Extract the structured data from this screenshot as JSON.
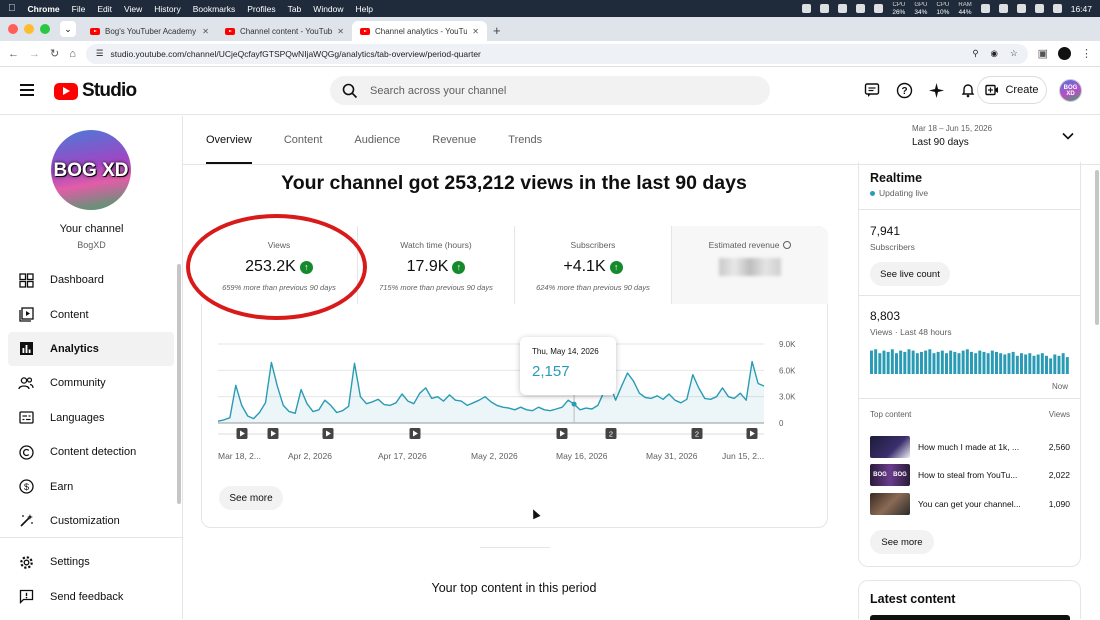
{
  "menubar": {
    "app": "Chrome",
    "items": [
      "File",
      "Edit",
      "View",
      "History",
      "Bookmarks",
      "Profiles",
      "Tab",
      "Window",
      "Help"
    ],
    "stats": [
      {
        "label": "CPU",
        "value": "26%"
      },
      {
        "label": "GPU",
        "value": "34%"
      },
      {
        "label": "CPU",
        "value": "10%"
      },
      {
        "label": "RAM",
        "value": "44%"
      }
    ],
    "clock": "16:47"
  },
  "browser": {
    "tabs": [
      {
        "title": "Bog's YouTuber Academy"
      },
      {
        "title": "Channel content - YouTube St"
      },
      {
        "title": "Channel analytics - YouTube S"
      }
    ],
    "url": "studio.youtube.com/channel/UCjeQcfayfGTSPQwNIjaWQGg/analytics/tab-overview/period-quarter"
  },
  "header": {
    "logo_text": "Studio",
    "search_placeholder": "Search across your channel",
    "create_label": "Create",
    "avatar_text": "BOG XD"
  },
  "sidebar": {
    "channel_avatar_text": "BOG XD",
    "your_channel": "Your channel",
    "channel_name": "BogXD",
    "items": [
      {
        "label": "Dashboard",
        "icon": "dashboard-icon"
      },
      {
        "label": "Content",
        "icon": "content-icon"
      },
      {
        "label": "Analytics",
        "icon": "analytics-icon"
      },
      {
        "label": "Community",
        "icon": "community-icon"
      },
      {
        "label": "Languages",
        "icon": "languages-icon"
      },
      {
        "label": "Content detection",
        "icon": "copyright-icon"
      },
      {
        "label": "Earn",
        "icon": "earn-icon"
      },
      {
        "label": "Customization",
        "icon": "customization-icon"
      }
    ],
    "bottom_items": [
      {
        "label": "Settings",
        "icon": "gear-icon"
      },
      {
        "label": "Send feedback",
        "icon": "feedback-icon"
      }
    ]
  },
  "tabs": [
    "Overview",
    "Content",
    "Audience",
    "Revenue",
    "Trends"
  ],
  "date_range": {
    "range": "Mar 18 – Jun 15, 2026",
    "label": "Last 90 days"
  },
  "main": {
    "headline": "Your channel got 253,212 views in the last 90 days",
    "metrics": [
      {
        "label": "Views",
        "value": "253.2K",
        "sub": "659% more than previous 90 days"
      },
      {
        "label": "Watch time (hours)",
        "value": "17.9K",
        "sub": "715% more than previous 90 days"
      },
      {
        "label": "Subscribers",
        "value": "+4.1K",
        "sub": "624% more than previous 90 days"
      },
      {
        "label": "Estimated revenue"
      }
    ],
    "tooltip": {
      "date": "Thu, May 14, 2026",
      "value": "2,157"
    },
    "see_more": "See more",
    "top_content_title": "Your top content in this period"
  },
  "chart_data": {
    "type": "line",
    "metric": "Views",
    "y_ticks": [
      "9.0K",
      "6.0K",
      "3.0K",
      "0"
    ],
    "ylim": [
      0,
      9000
    ],
    "x_ticks": [
      "Mar 18, 2...",
      "Apr 2, 2026",
      "Apr 17, 2026",
      "May 2, 2026",
      "May 16, 2026",
      "May 31, 2026",
      "Jun 15, 2..."
    ],
    "values": [
      200,
      350,
      600,
      4300,
      2000,
      800,
      500,
      1200,
      2300,
      6900,
      4200,
      2000,
      1300,
      1100,
      3800,
      2200,
      1300,
      1500,
      2600,
      2000,
      1200,
      1400,
      1900,
      6800,
      3000,
      2200,
      2400,
      2700,
      2100,
      2000,
      2300,
      3300,
      2500,
      2200,
      3400,
      4000,
      2800,
      3000,
      2500,
      3200,
      2600,
      2500,
      2000,
      2300,
      2600,
      3000,
      2400,
      2000,
      1800,
      1700,
      1500,
      1800,
      1500,
      1400,
      1800,
      1500,
      1400,
      1600,
      1800,
      2600,
      2157,
      1500,
      1700,
      1600,
      2000,
      3500,
      4500,
      2600,
      4200,
      5700,
      4800,
      3400,
      2900,
      2800,
      3100,
      2700,
      3300,
      2600,
      2300,
      2700,
      5500,
      4000,
      2800,
      2700,
      3000,
      4000,
      3000,
      2800,
      3400,
      2600,
      7000,
      4500,
      4200
    ],
    "markers": [
      "",
      "",
      "",
      "",
      "",
      "2",
      "2",
      ""
    ],
    "color": "#2a9bb5"
  },
  "realtime": {
    "title": "Realtime",
    "status": "Updating live",
    "subscribers": "7,941",
    "subscribers_label": "Subscribers",
    "live_count_button": "See live count",
    "views": "8,803",
    "views_label": "Views · Last 48 hours",
    "now_label": "Now",
    "bars": [
      0.9,
      0.95,
      0.8,
      0.9,
      0.85,
      0.95,
      0.8,
      0.9,
      0.85,
      0.95,
      0.9,
      0.8,
      0.85,
      0.9,
      0.95,
      0.8,
      0.85,
      0.9,
      0.8,
      0.9,
      0.85,
      0.8,
      0.9,
      0.95,
      0.85,
      0.8,
      0.9,
      0.85,
      0.8,
      0.9,
      0.85,
      0.8,
      0.75,
      0.8,
      0.85,
      0.7,
      0.8,
      0.75,
      0.8,
      0.7,
      0.75,
      0.8,
      0.7,
      0.6,
      0.75,
      0.7,
      0.8,
      0.65
    ],
    "top_content_label": "Top content",
    "views_col_label": "Views",
    "top_content": [
      {
        "title": "How much I made at 1k, ...",
        "views": "2,560"
      },
      {
        "title": "How to steal from YouTu...",
        "views": "2,022"
      },
      {
        "title": "You can get your channel...",
        "views": "1,090"
      }
    ],
    "see_more": "See more"
  },
  "latest_content": {
    "title": "Latest content"
  }
}
